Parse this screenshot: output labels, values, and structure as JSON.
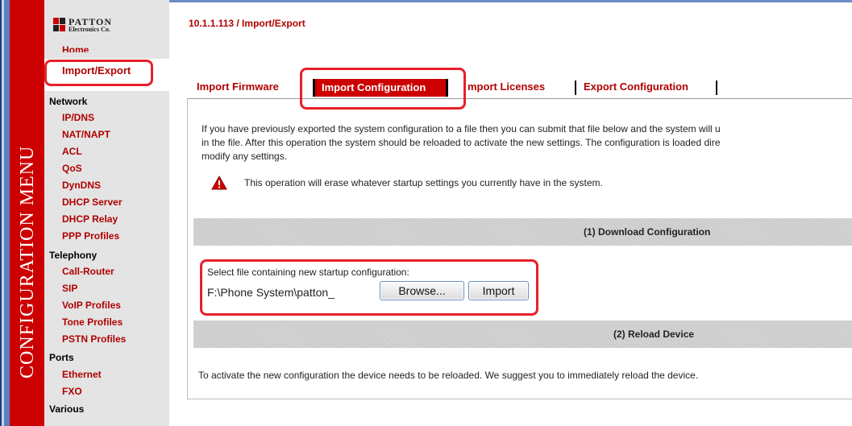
{
  "menu_strip": {
    "title": "CONFIGURATION MENU"
  },
  "logo": {
    "main": "PATTON",
    "sub": "Electronics Co."
  },
  "sidebar": {
    "home": "Home",
    "import_export": "Import/Export",
    "sections": [
      {
        "title": "Network",
        "items": [
          "IP/DNS",
          "NAT/NAPT",
          "ACL",
          "QoS",
          "DynDNS",
          "DHCP Server",
          "DHCP Relay",
          "PPP Profiles"
        ]
      },
      {
        "title": "Telephony",
        "items": [
          "Call-Router",
          "SIP",
          "VoIP Profiles",
          "Tone Profiles",
          "PSTN Profiles"
        ]
      },
      {
        "title": "Ports",
        "items": [
          "Ethernet",
          "FXO"
        ]
      },
      {
        "title": "Various",
        "items": []
      }
    ]
  },
  "breadcrumb": "10.1.1.113 / Import/Export",
  "tabs": {
    "import_firmware": "Import Firmware",
    "import_configuration": "Import Configuration",
    "import_licenses": "mport Licenses",
    "export_configuration": "Export Configuration"
  },
  "description": {
    "line1": "If you have previously exported the system configuration to a file then you can submit that file below and the system will u",
    "line2": "in the file. After this operation the system should be reloaded to activate the new settings. The configuration is loaded dire",
    "line3": "modify any settings."
  },
  "warning": {
    "icon": "warning-triangle-icon",
    "text": "This operation will erase whatever startup settings you currently have in the system."
  },
  "download_section": {
    "title": "(1) Download Configuration",
    "file_label": "Select file containing new startup configuration:",
    "file_value": "F:\\Phone System\\patton_",
    "browse_label": "Browse...",
    "import_label": "Import"
  },
  "reload_section": {
    "title": "(2) Reload Device",
    "text": "To activate the new configuration the device needs to be reloaded. We suggest you to immediately reload the device."
  },
  "colors": {
    "brand_red": "#cc0000",
    "link_red": "#b00000",
    "highlight": "#e8202a"
  }
}
